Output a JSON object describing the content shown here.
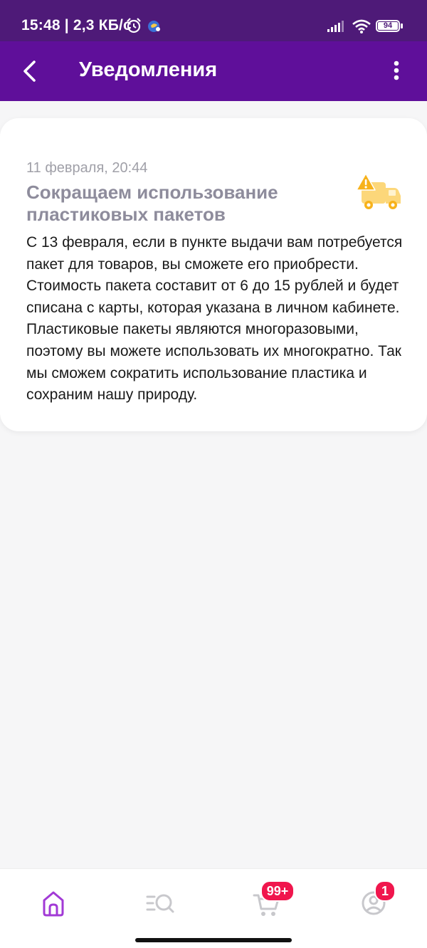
{
  "status_bar": {
    "time": "15:48 | 2,3 КБ/с",
    "battery": "94"
  },
  "app_bar": {
    "title": "Уведомления"
  },
  "notification": {
    "date": "11 февраля, 20:44",
    "title": "Сокращаем использование пластиковых пакетов",
    "body": "С 13 февраля, если в пункте выдачи вам потребуется пакет для товаров, вы сможете его приобрести. Стоимость пакета составит от 6 до 15 рублей и будет списана с карты, которая указана в личном кабинете. Пластиковые пакеты являются многоразовыми, поэтому вы можете использовать их многократно. Так мы сможем сократить использование пластика и сохраним нашу природу.",
    "icon": "truck-warning-icon"
  },
  "bottom_nav": {
    "items": [
      {
        "icon": "home-icon",
        "active": true
      },
      {
        "icon": "catalog-search-icon",
        "active": false
      },
      {
        "icon": "cart-icon",
        "active": false,
        "badge": "99+"
      },
      {
        "icon": "profile-icon",
        "active": false,
        "badge": "1"
      }
    ]
  },
  "colors": {
    "status_bar": "#4e1a78",
    "app_bar": "#5f0f9a",
    "active_nav": "#a23ad6",
    "inactive_nav": "#c8c8cc",
    "badge": "#f0164d",
    "icon_accent": "#f7b21b"
  }
}
